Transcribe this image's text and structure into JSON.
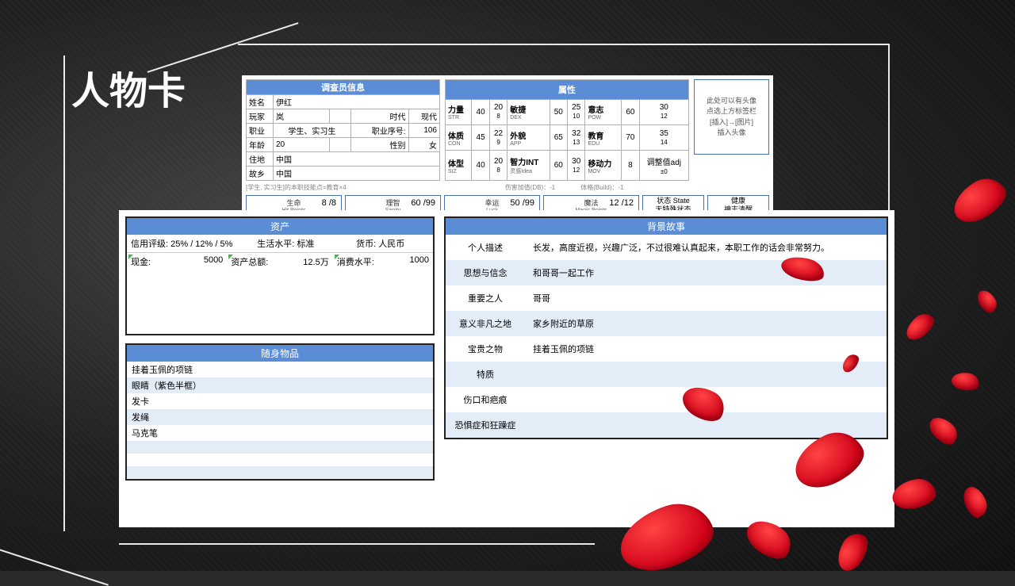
{
  "title": "人物卡",
  "investigator_header": "调查员信息",
  "inv": {
    "name_l": "姓名",
    "name_v": "伊红",
    "player_l": "玩家",
    "player_v": "岚",
    "era_l": "时代",
    "era_v": "现代",
    "occ_l": "职业",
    "occ_v": "学生、实习生",
    "occno_l": "职业序号:",
    "occno_v": "106",
    "age_l": "年龄",
    "age_v": "20",
    "sex_l": "性别",
    "sex_v": "女",
    "res_l": "住地",
    "res_v": "中国",
    "home_l": "故乡",
    "home_v": "中国"
  },
  "skill_note": "[学生, 实习生]的本职技能点=教育×4",
  "attrs_header": "属性",
  "attrs": [
    {
      "l": "力量",
      "s": "STR",
      "v": "40",
      "h": "20",
      "q": "8",
      "l2": "敏捷",
      "s2": "DEX",
      "v2": "50",
      "h2": "25",
      "q2": "10",
      "l3": "意志",
      "s3": "POW",
      "v3": "60",
      "h3": "30",
      "q3": "12"
    },
    {
      "l": "体质",
      "s": "CON",
      "v": "45",
      "h": "22",
      "q": "9",
      "l2": "外貌",
      "s2": "APP",
      "v2": "65",
      "h2": "32",
      "q2": "13",
      "l3": "教育",
      "s3": "EDU",
      "v3": "70",
      "h3": "35",
      "q3": "14"
    },
    {
      "l": "体型",
      "s": "SIZ",
      "v": "40",
      "h": "20",
      "q": "8",
      "l2": "智力INT",
      "s2": "灵感Idea",
      "v2": "60",
      "h2": "30",
      "q2": "12",
      "l3": "移动力",
      "s3": "MOV",
      "v3": "8",
      "h3": "调整值adj",
      "q3": "±0"
    }
  ],
  "dmg_note": "伤害加值(DB)：-1　　　　体格(Build)：-1",
  "avatar_hint": "此处可以有头像\n点选上方标签栏\n[插入]→[图片]\n插入头像",
  "stats": {
    "hp_l": "生命",
    "hp_s": "Hit  Points",
    "hp_v": "8 /8",
    "san_l": "理智",
    "san_s": "Sanity",
    "san_v": "60 /99",
    "luck_l": "幸运",
    "luck_s": "Luck",
    "luck_v": "50 /99",
    "mp_l": "魔法",
    "mp_s": "Magic Points",
    "mp_v": "12 /12",
    "state_l": "状态 State",
    "state_v": "无特殊状态",
    "health_l": "健康",
    "health_v": "神志清醒"
  },
  "assets_header": "资产",
  "assets": {
    "credit_l": "信用评级:",
    "credit_v": "25% / 12% / 5%",
    "living_l": "生活水平:",
    "living_v": "标准",
    "curr_l": "货币:",
    "curr_v": "人民币",
    "cash_l": "现金:",
    "cash_v": "5000",
    "total_l": "资产总额:",
    "total_v": "12.5万",
    "spend_l": "消费水平:",
    "spend_v": "1000"
  },
  "items_header": "随身物品",
  "items": [
    "挂着玉佩的项链",
    "眼睛（紫色半框）",
    "发卡",
    "发绳",
    "马克笔",
    "",
    "",
    ""
  ],
  "story_header": "背景故事",
  "story": [
    {
      "l": "个人描述",
      "v": "长发，高度近视，兴趣广泛，不过很难认真起来，本职工作的话会非常努力。"
    },
    {
      "l": "思想与信念",
      "v": "和哥哥一起工作"
    },
    {
      "l": "重要之人",
      "v": "哥哥"
    },
    {
      "l": "意义非凡之地",
      "v": "家乡附近的草原"
    },
    {
      "l": "宝贵之物",
      "v": "挂着玉佩的项链"
    },
    {
      "l": "特质",
      "v": ""
    },
    {
      "l": "伤口和疤痕",
      "v": ""
    },
    {
      "l": "恐惧症和狂躁症",
      "v": ""
    }
  ]
}
